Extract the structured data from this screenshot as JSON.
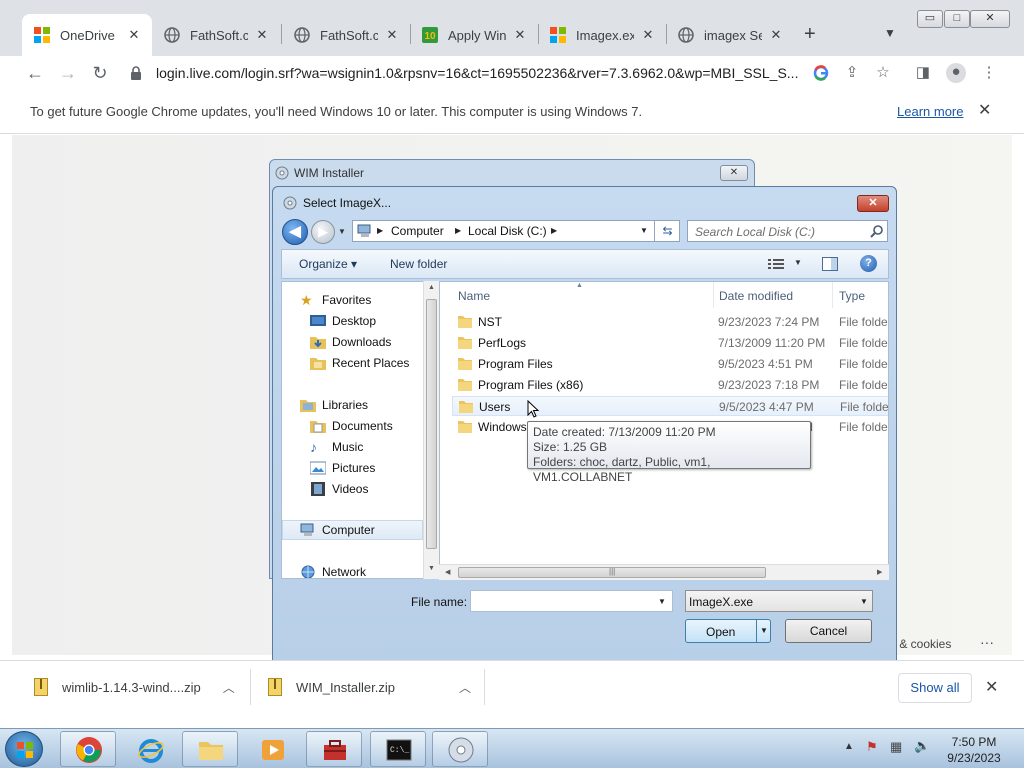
{
  "window": {
    "minimize": "▭",
    "maximize": "□",
    "close": "✕"
  },
  "tabs": [
    {
      "label": "OneDrive",
      "icon": "microsoft-logo",
      "active": true
    },
    {
      "label": "FathSoft.com",
      "icon": "globe-icon"
    },
    {
      "label": "FathSoft.com",
      "icon": "globe-icon"
    },
    {
      "label": "Apply Windows",
      "icon": "win10-icon"
    },
    {
      "label": "Imagex.exe",
      "icon": "microsoft-logo"
    },
    {
      "label": "imagex Search",
      "icon": "globe-icon"
    }
  ],
  "tab_close": "✕",
  "new_tab": "+",
  "toolbar": {
    "back": "←",
    "forward": "→",
    "reload": "↻",
    "url": "login.live.com/login.srf?wa=wsignin1.0&rpsnv=16&ct=1695502236&rver=7.3.6962.0&wp=MBI_SSL_S..."
  },
  "infobar": {
    "text": "To get future Google Chrome updates, you'll need Windows 10 or later. This computer is using Windows 7.",
    "learn_more": "Learn more",
    "close": "✕"
  },
  "page": {
    "privacy": "cy & cookies",
    "dots": "···"
  },
  "wim_installer": {
    "title": "WIM Installer",
    "close": "✕"
  },
  "dialog": {
    "title": "Select ImageX...",
    "close": "✕",
    "breadcrumb": [
      "Computer",
      "Local Disk (C:)"
    ],
    "search_placeholder": "Search Local Disk (C:)",
    "organize": "Organize ▾",
    "new_folder": "New folder",
    "help": "?",
    "nav": [
      {
        "label": "Favorites",
        "icon": "star-icon",
        "level": 0
      },
      {
        "label": "Desktop",
        "icon": "desktop-icon",
        "level": 1
      },
      {
        "label": "Downloads",
        "icon": "downloads-icon",
        "level": 1
      },
      {
        "label": "Recent Places",
        "icon": "recent-places-icon",
        "level": 1
      },
      {
        "label": "Libraries",
        "icon": "libraries-icon",
        "level": 0
      },
      {
        "label": "Documents",
        "icon": "documents-icon",
        "level": 1
      },
      {
        "label": "Music",
        "icon": "music-icon",
        "level": 1
      },
      {
        "label": "Pictures",
        "icon": "pictures-icon",
        "level": 1
      },
      {
        "label": "Videos",
        "icon": "videos-icon",
        "level": 1
      },
      {
        "label": "Computer",
        "icon": "computer-icon",
        "level": 0,
        "selected": true
      },
      {
        "label": "Network",
        "icon": "network-icon",
        "level": 0
      }
    ],
    "columns": {
      "name": "Name",
      "date": "Date modified",
      "type": "Type"
    },
    "files": [
      {
        "name": "NST",
        "date": "9/23/2023 7:24 PM",
        "type": "File folder"
      },
      {
        "name": "PerfLogs",
        "date": "7/13/2009 11:20 PM",
        "type": "File folder"
      },
      {
        "name": "Program Files",
        "date": "9/5/2023 4:51 PM",
        "type": "File folder"
      },
      {
        "name": "Program Files (x86)",
        "date": "9/23/2023 7:18 PM",
        "type": "File folder"
      },
      {
        "name": "Users",
        "date": "9/5/2023 4:47 PM",
        "type": "File folder",
        "hover": true
      },
      {
        "name": "Windows",
        "date": "M",
        "type": "File folder"
      }
    ],
    "tooltip": [
      "Date created: 7/13/2009 11:20 PM",
      "Size: 1.25 GB",
      "Folders: choc, dartz, Public, vm1, VM1.COLLABNET"
    ],
    "file_name_label": "File name:",
    "file_name_value": "",
    "file_type": "ImageX.exe",
    "open": "Open",
    "cancel": "Cancel"
  },
  "downloads": [
    {
      "name": "wimlib-1.14.3-wind....zip"
    },
    {
      "name": "WIM_Installer.zip"
    }
  ],
  "downloads_show_all": "Show all",
  "downloads_close": "✕",
  "taskbar": {
    "apps": [
      "chrome-icon",
      "ie-icon",
      "explorer-icon",
      "media-player-icon",
      "toolbox-icon",
      "cmd-icon",
      "disc-icon"
    ],
    "tray": "▲",
    "time": "7:50 PM",
    "date": "9/23/2023"
  },
  "colors": {
    "accent_blue": "#1a56a8",
    "dialog_frame": "#b8cfe8",
    "close_red": "#c3412b"
  }
}
